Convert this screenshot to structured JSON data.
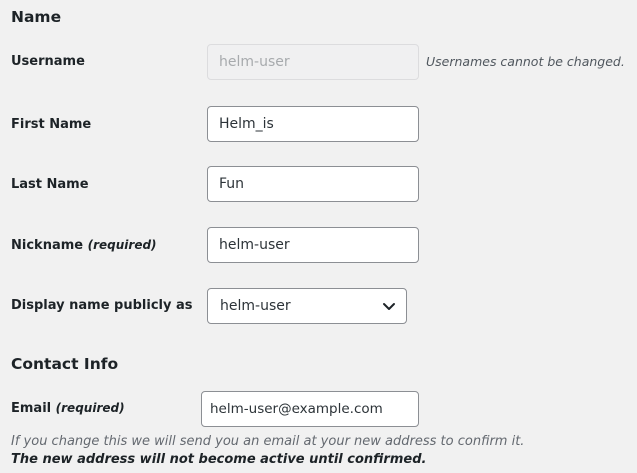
{
  "sections": {
    "name_title": "Name",
    "contact_title": "Contact Info"
  },
  "username": {
    "label": "Username",
    "value": "helm-user",
    "note": "Usernames cannot be changed."
  },
  "first_name": {
    "label": "First Name",
    "value": "Helm_is"
  },
  "last_name": {
    "label": "Last Name",
    "value": "Fun"
  },
  "nickname": {
    "label": "Nickname",
    "required": "(required)",
    "value": "helm-user"
  },
  "display_name": {
    "label": "Display name publicly as",
    "selected": "helm-user",
    "icon": "chevron-down-icon"
  },
  "email": {
    "label": "Email",
    "required": "(required)",
    "value": "helm-user@example.com",
    "description_line1": "If you change this we will send you an email at your new address to confirm it.",
    "description_line2": "The new address will not become active until confirmed."
  }
}
